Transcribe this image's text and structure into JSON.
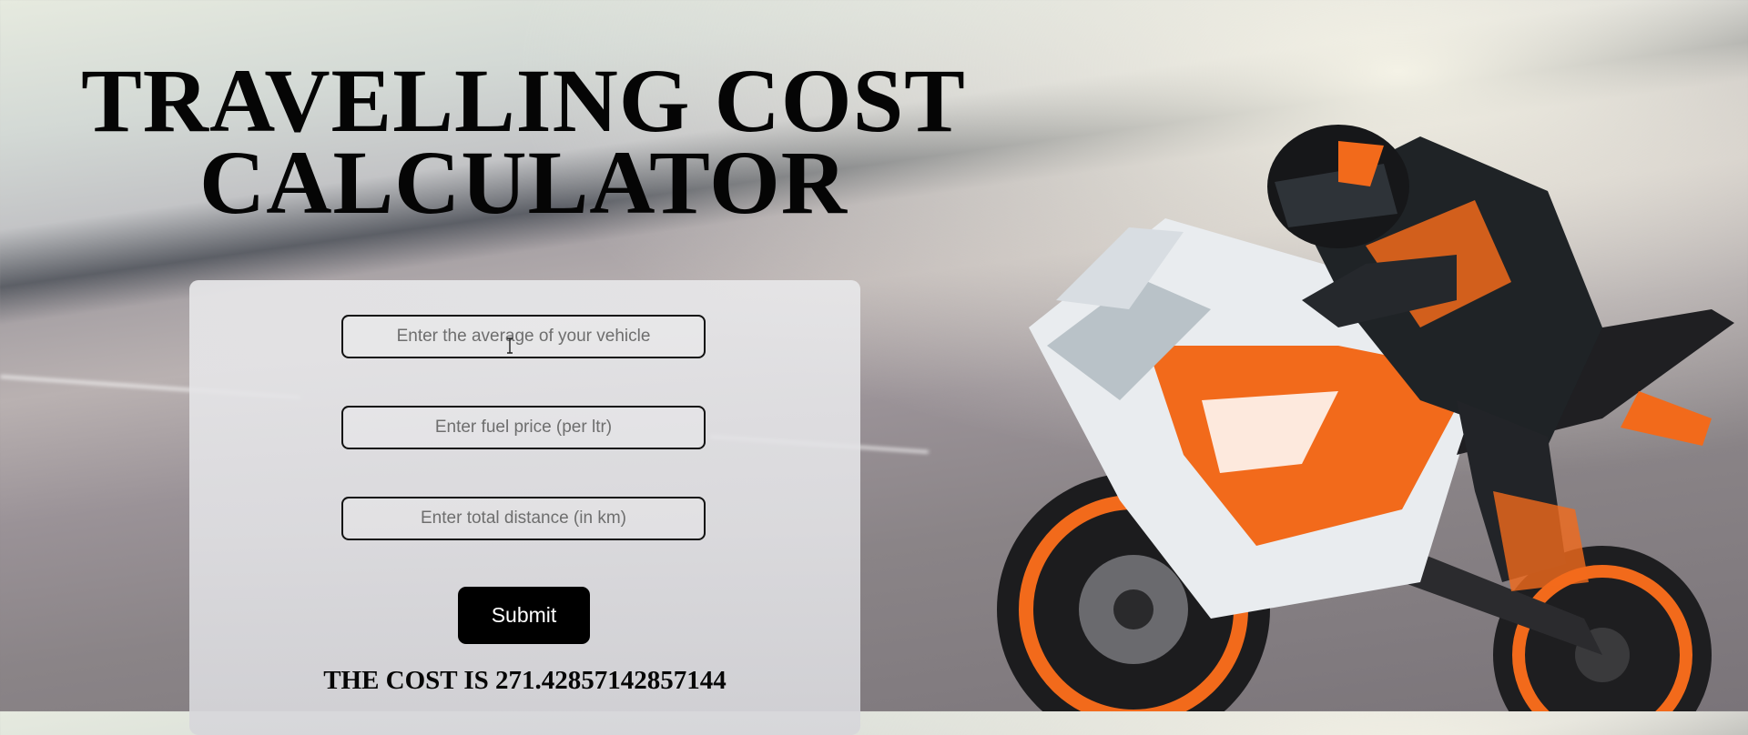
{
  "page": {
    "title": "TRAVELLING COST CALCULATOR"
  },
  "form": {
    "average": {
      "placeholder": "Enter the average of your vehicle",
      "value": ""
    },
    "fuel_price": {
      "placeholder": "Enter fuel price (per ltr)",
      "value": ""
    },
    "distance": {
      "placeholder": "Enter total distance (in km)",
      "value": ""
    },
    "submit_label": "Submit"
  },
  "result": {
    "text": "THE COST IS 271.42857142857144"
  },
  "colors": {
    "title_text": "#050505",
    "button_bg": "#000000",
    "button_text": "#ffffff",
    "panel_bg": "#e4e4e7",
    "accent_orange": "#f26a1b"
  },
  "background": {
    "image": "motorcycle-rider-photo"
  }
}
